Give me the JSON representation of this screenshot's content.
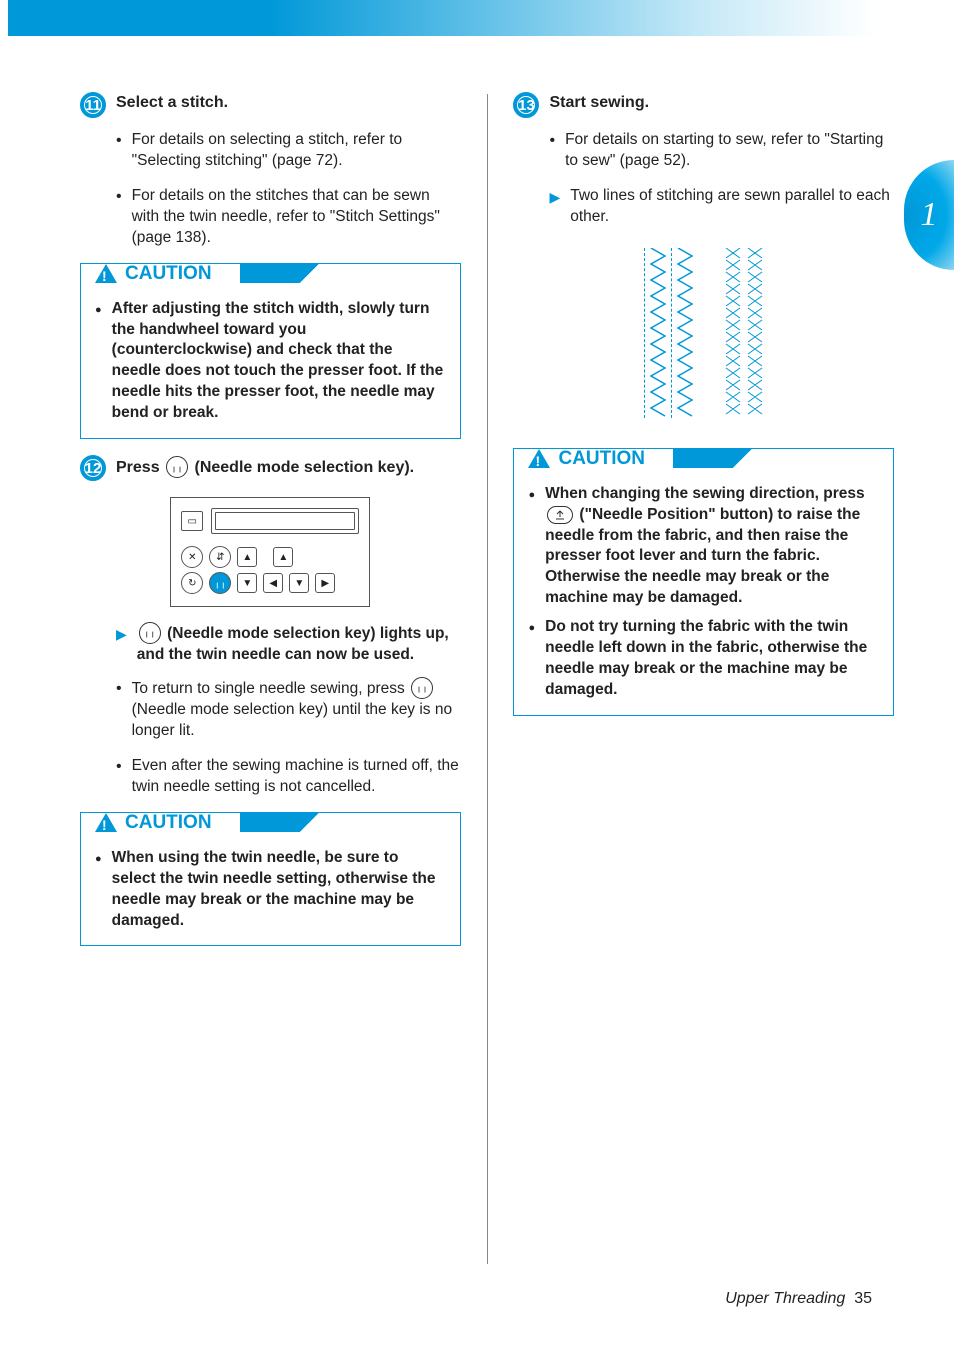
{
  "side_tab": "1",
  "left": {
    "step11": {
      "num": "11",
      "title": "Select a stitch.",
      "bullets": [
        "For details on selecting a stitch, refer to \"Selecting stitching\" (page 72).",
        "For details on the stitches that can be sewn with the twin needle, refer to \"Stitch Settings\" (page 138)."
      ]
    },
    "caution1": {
      "label": "CAUTION",
      "items": [
        "After adjusting the stitch width, slowly turn the handwheel toward you (counterclockwise) and check that the needle does not touch the presser foot. If the needle hits the presser foot, the needle may bend or break."
      ]
    },
    "step12": {
      "num": "12",
      "title_before": "Press ",
      "title_after": " (Needle mode selection key).",
      "arrow_before": "",
      "arrow_text": " (Needle mode selection key) lights up, and the twin needle can now be used.",
      "bullets": [
        "To return to single needle sewing, press       (Needle mode selection key) until the key is no longer lit.",
        "Even after the sewing machine is turned off, the twin needle setting is not cancelled."
      ],
      "bullet1_before": "To return to single needle sewing, press ",
      "bullet1_after": " (Needle mode selection key) until the key is no longer lit.",
      "bullet2": "Even after the sewing machine is turned off, the twin needle setting is not cancelled."
    },
    "caution2": {
      "label": "CAUTION",
      "items": [
        "When using the twin needle, be sure to select the twin needle setting, otherwise the needle may break or the machine may be damaged."
      ]
    }
  },
  "right": {
    "step13": {
      "num": "13",
      "title": "Start sewing.",
      "bullets": [
        "For details on starting to sew, refer to \"Starting to sew\" (page 52)."
      ],
      "arrow_text": "Two lines of stitching are sewn parallel to each other."
    },
    "caution3": {
      "label": "CAUTION",
      "item1_before": "When changing the sewing direction, press ",
      "item1_after": " (\"Needle Position\" button) to raise the needle from the fabric, and then raise the presser foot lever and turn the fabric. Otherwise the needle may break or the machine may be damaged.",
      "item2": "Do not try turning the fabric with the twin needle left down in the fabric, otherwise the needle may break or the machine may be damaged."
    }
  },
  "footer": {
    "title": "Upper Threading",
    "page": "35"
  }
}
